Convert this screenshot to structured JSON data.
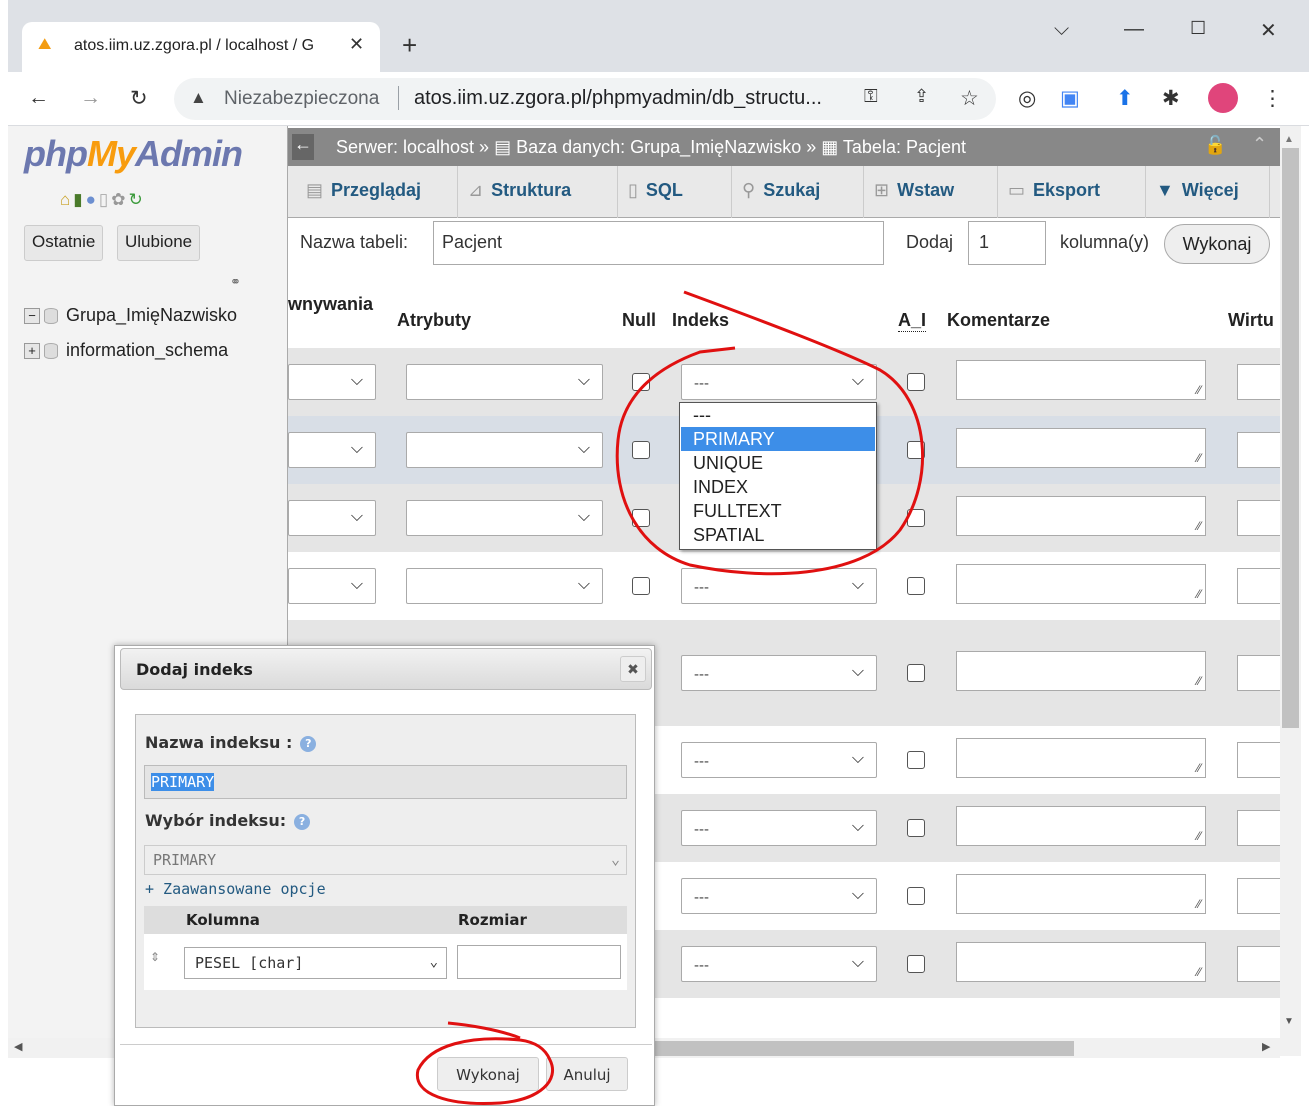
{
  "browser": {
    "tab_title": "atos.iim.uz.zgora.pl / localhost / G",
    "omnibox_status": "Niezabezpieczona",
    "url": "atos.iim.uz.zgora.pl/phpmyadmin/db_structu..."
  },
  "sidebar": {
    "logo": {
      "php": "php",
      "my": "My",
      "admin": "Admin"
    },
    "buttons": [
      "Ostatnie",
      "Ulubione"
    ],
    "databases": [
      "Grupa_ImięNazwisko",
      "information_schema"
    ]
  },
  "breadcrumb": {
    "text": "Serwer: localhost » ▤ Baza danych: Grupa_ImięNazwisko » ▦ Tabela: Pacjent"
  },
  "menu": [
    "Przeglądaj",
    "Struktura",
    "SQL",
    "Szukaj",
    "Wstaw",
    "Eksport",
    "Więcej"
  ],
  "table_form": {
    "name_label": "Nazwa tabeli:",
    "name_value": "Pacjent",
    "add_label": "Dodaj",
    "add_value": "1",
    "col_label": "kolumna(y)",
    "go_label": "Wykonaj"
  },
  "columns": {
    "collation": "wnywania",
    "attributes": "Atrybuty",
    "null": "Null",
    "index": "Indeks",
    "ai": "A_I",
    "comments": "Komentarze",
    "virtual": "Wirtu"
  },
  "index_select_default": "---",
  "index_options": [
    "---",
    "PRIMARY",
    "UNIQUE",
    "INDEX",
    "FULLTEXT",
    "SPATIAL"
  ],
  "index_selected_option": "PRIMARY",
  "dialog": {
    "title": "Dodaj indeks",
    "name_label": "Nazwa indeksu :",
    "name_value": "PRIMARY",
    "type_label": "Wybór indeksu:",
    "type_value": "PRIMARY",
    "advanced_link": "+ Zaawansowane opcje",
    "col_header": "Kolumna",
    "size_header": "Rozmiar",
    "column_value": "PESEL [char]",
    "ok_label": "Wykonaj",
    "cancel_label": "Anuluj"
  },
  "colors": {
    "annotation": "#e01010",
    "selected": "#3d8ee8",
    "link": "#235a81"
  }
}
